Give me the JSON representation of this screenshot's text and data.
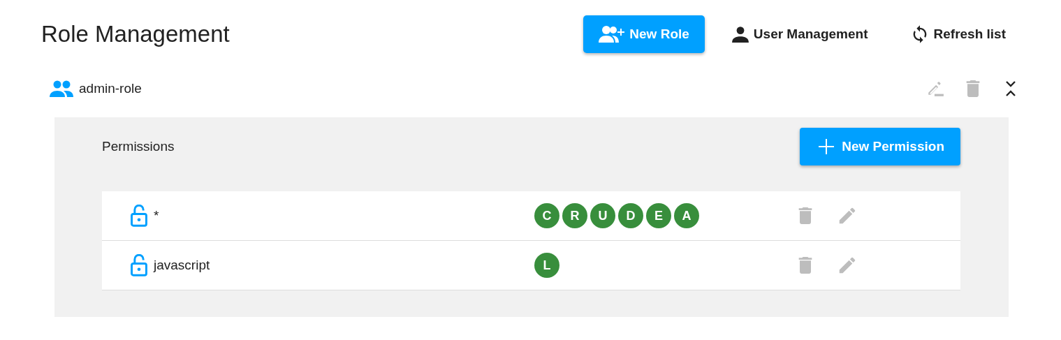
{
  "header": {
    "title": "Role Management",
    "actions": [
      {
        "kind": "primary",
        "label": "New Role"
      },
      {
        "kind": "plain",
        "label": "User Management"
      },
      {
        "kind": "plain",
        "label": "Refresh list"
      }
    ]
  },
  "roles": [
    {
      "name": "admin-role",
      "expanded": true,
      "permissions_title": "Permissions",
      "new_permission_label": "New Permission",
      "permissions": [
        {
          "name": "*",
          "flags": [
            "C",
            "R",
            "U",
            "D",
            "E",
            "A"
          ]
        },
        {
          "name": "javascript",
          "flags": [
            "L"
          ]
        }
      ]
    }
  ]
}
